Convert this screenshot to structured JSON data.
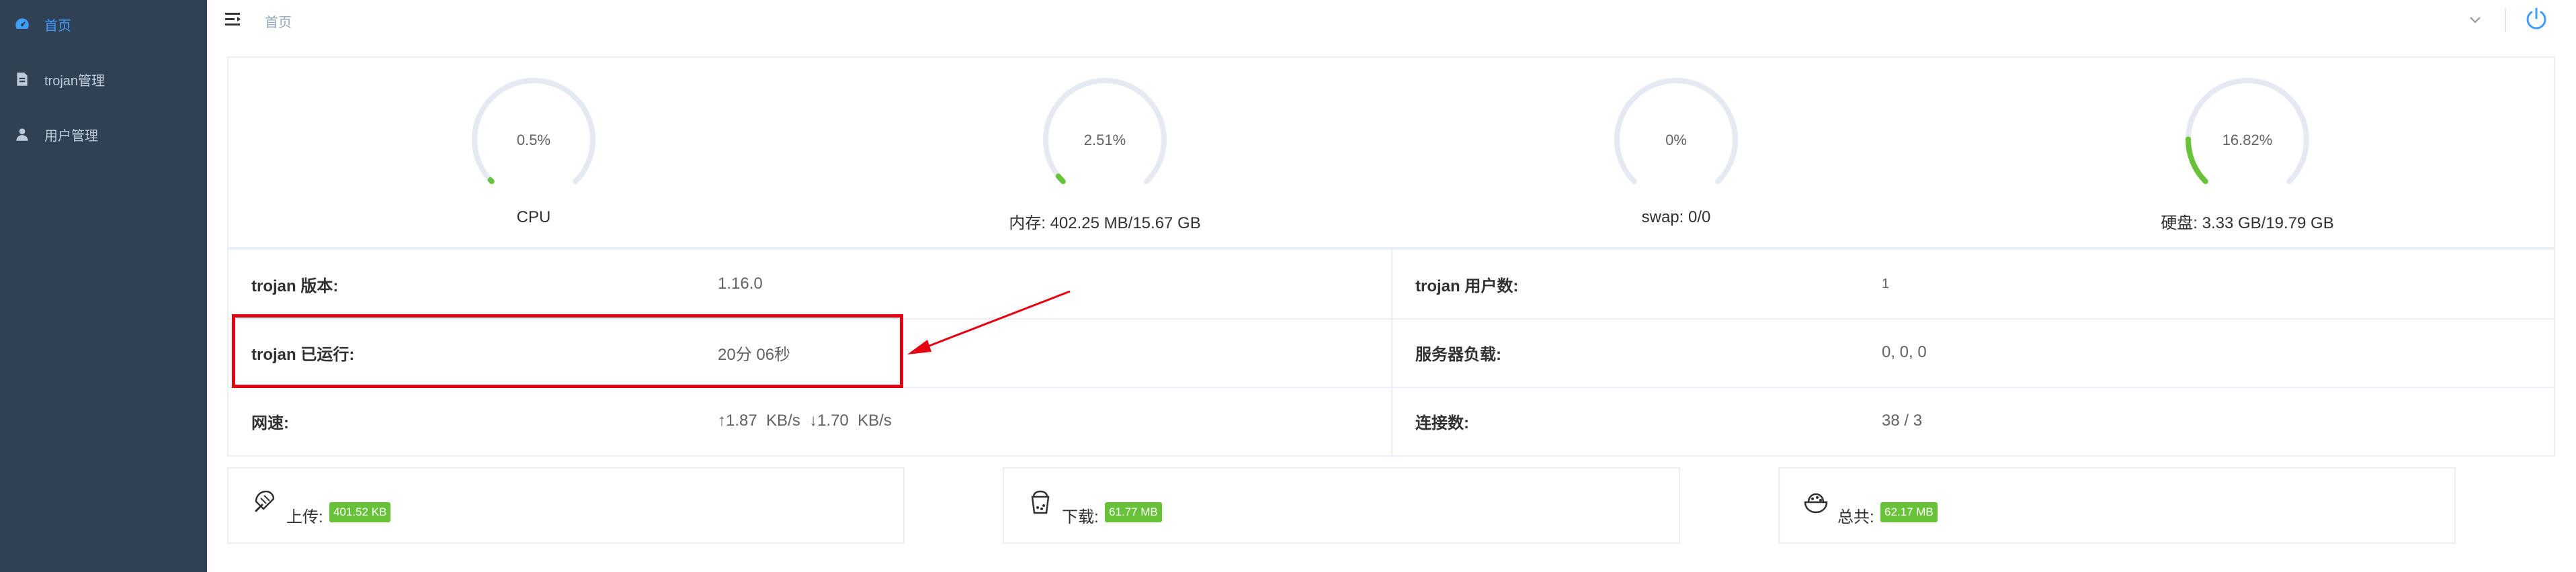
{
  "sidebar": {
    "items": [
      {
        "label": "首页",
        "icon": "dashboard-icon"
      },
      {
        "label": "trojan管理",
        "icon": "document-icon"
      },
      {
        "label": "用户管理",
        "icon": "user-icon"
      }
    ]
  },
  "navbar": {
    "breadcrumb": "首页"
  },
  "gauges": [
    {
      "value_text": "0.5%",
      "percent": 0.5,
      "label": "CPU"
    },
    {
      "value_text": "2.51%",
      "percent": 2.51,
      "label": "内存: 402.25 MB/15.67 GB"
    },
    {
      "value_text": "0%",
      "percent": 0,
      "label": "swap: 0/0"
    },
    {
      "value_text": "16.82%",
      "percent": 16.82,
      "label": "硬盘: 3.33 GB/19.79 GB"
    }
  ],
  "info": {
    "version_label": "trojan 版本:",
    "version_value": "1.16.0",
    "users_label": "trojan 用户数:",
    "users_value": "1",
    "uptime_label": "trojan 已运行:",
    "uptime_value": "20分 06秒",
    "load_label": "服务器负载:",
    "load_value": "0, 0, 0",
    "speed_label": "网速:",
    "speed_value": "↑1.87  KB/s  ↓1.70  KB/s",
    "conn_label": "连接数:",
    "conn_value": "38 / 3"
  },
  "stats": [
    {
      "label": "上传:",
      "value": "401.52 KB",
      "icon": "ice-cream-icon"
    },
    {
      "label": "下载:",
      "value": "61.77 MB",
      "icon": "milk-tea-icon"
    },
    {
      "label": "总共:",
      "value": "62.17 MB",
      "icon": "bowl-icon"
    }
  ],
  "colors": {
    "sidebar_bg": "#304156",
    "active": "#409eff",
    "gauge_track": "#e5e9f2",
    "gauge_fill": "#67c23a",
    "highlight": "#e60012",
    "tag_bg": "#67c23a"
  }
}
